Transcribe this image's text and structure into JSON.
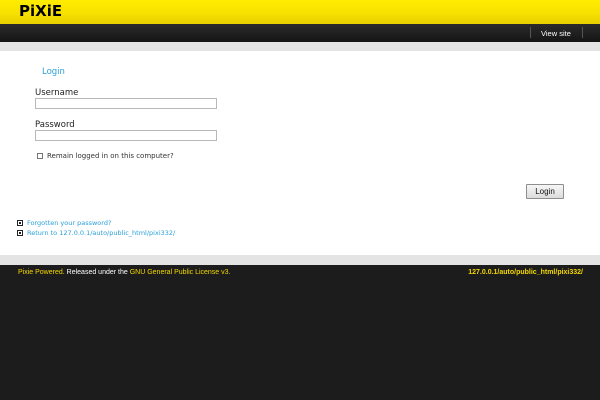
{
  "header": {
    "logo_text": "PiXiE",
    "view_site_label": "View site"
  },
  "login_form": {
    "heading": "Login",
    "username_label": "Username",
    "username_value": "",
    "password_label": "Password",
    "password_value": "",
    "remember_label": "Remain logged in on this computer?",
    "remember_checked": false,
    "submit_label": "Login"
  },
  "links": {
    "forgot_password": "Forgotten your password?",
    "return_site": "Return to 127.0.0.1/auto/public_html/pixi332/"
  },
  "footer": {
    "powered": "Pixie Powered.",
    "released_text": "Released under the",
    "license_link": "GNU General Public License v3.",
    "site_url": "127.0.0.1/auto/public_html/pixi332/"
  },
  "colors": {
    "accent_yellow": "#f5d800",
    "link_blue": "#2a9fd8",
    "dark_bg": "#1c1c1c"
  }
}
